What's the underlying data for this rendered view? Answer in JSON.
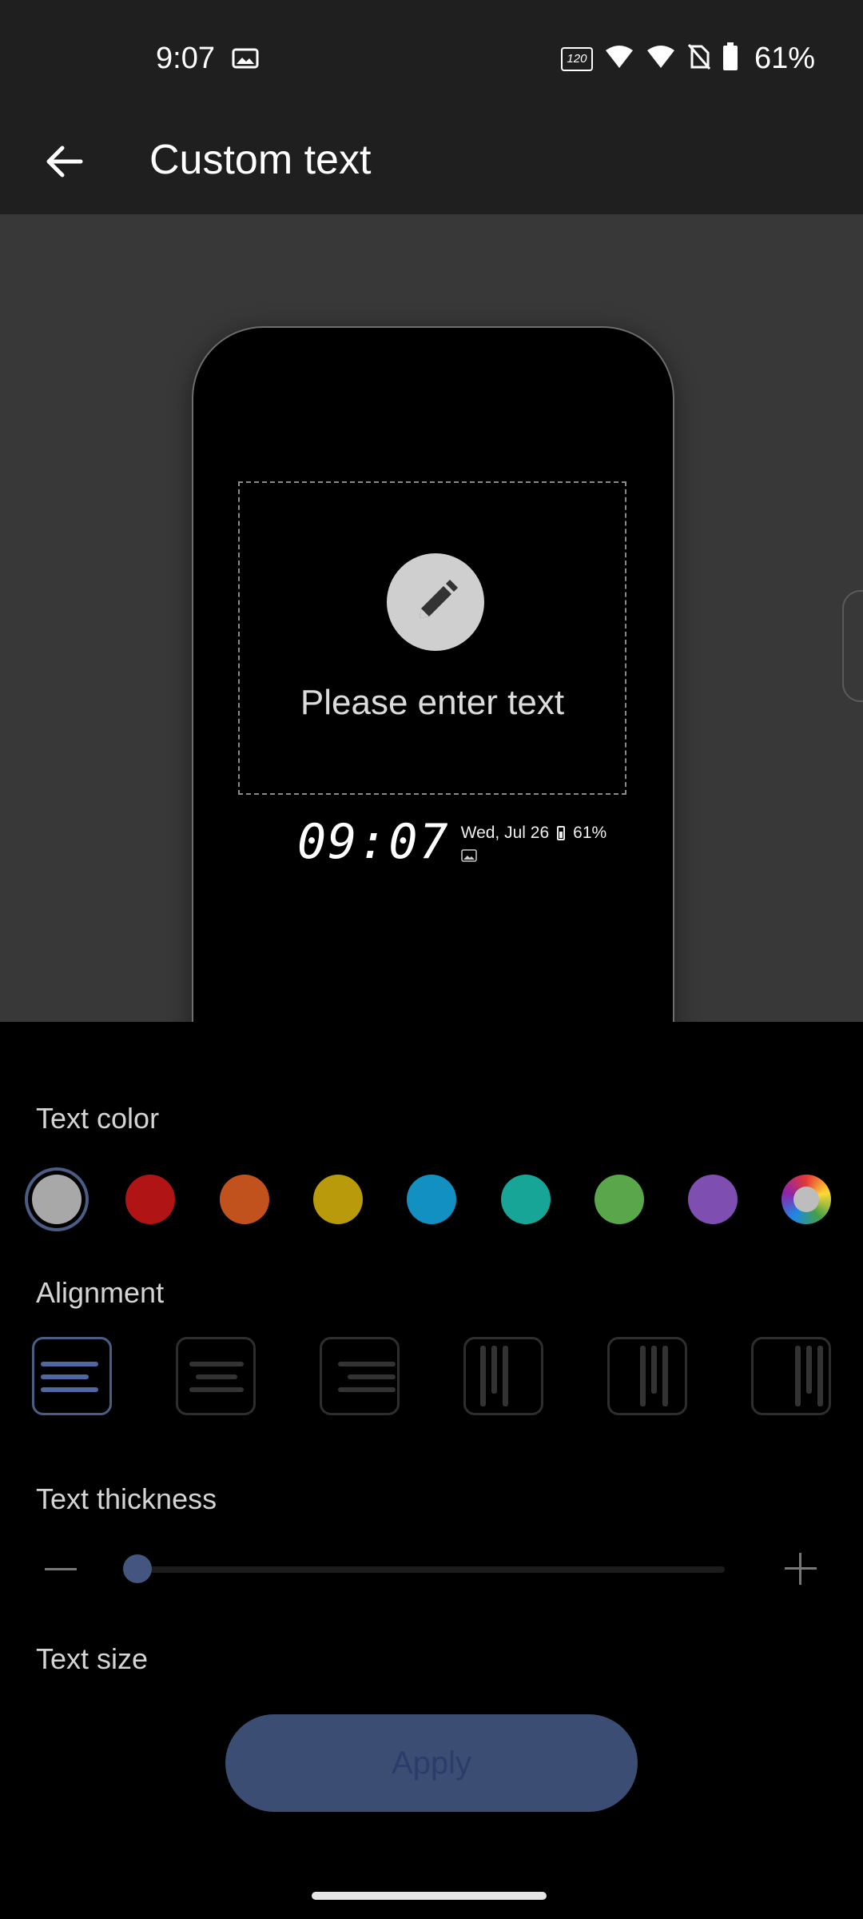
{
  "status_bar": {
    "time": "9:07",
    "refresh_badge": "120",
    "battery_percent": "61%",
    "icons": [
      "gallery-icon",
      "refresh-rate-icon",
      "wifi-icon",
      "signal-icon",
      "no-sim-icon",
      "battery-icon"
    ]
  },
  "app_bar": {
    "title": "Custom text",
    "back_icon": "arrow-left-icon"
  },
  "preview": {
    "placeholder": "Please enter text",
    "edit_icon": "pencil-icon",
    "clock_time": "09:07",
    "clock_date": "Wed, Jul 26",
    "clock_battery": "61%"
  },
  "sections": {
    "text_color": "Text color",
    "alignment": "Alignment",
    "text_thickness": "Text thickness",
    "text_size": "Text size"
  },
  "colors": {
    "selected_index": 0,
    "swatches": [
      "#a8a8a8",
      "#b01414",
      "#c2521d",
      "#b89a0a",
      "#1290c2",
      "#16a596",
      "#5aa64a",
      "#7e4fb0",
      "multicolor"
    ]
  },
  "alignment": {
    "selected_index": 0,
    "options": [
      "align-left-icon",
      "align-center-icon",
      "align-right-icon",
      "vertical-left-icon",
      "vertical-center-icon",
      "vertical-right-icon"
    ]
  },
  "thickness": {
    "value": 0.0
  },
  "apply_label": "Apply",
  "accent_color": "#44567f"
}
